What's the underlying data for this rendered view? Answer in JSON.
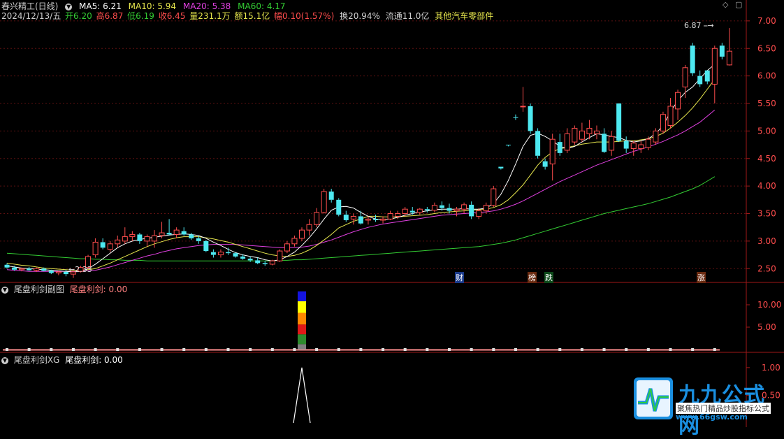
{
  "header": {
    "title": "春兴精工(日线)",
    "ma5": "MA5: 6.21",
    "ma10": "MA10: 5.94",
    "ma20": "MA20: 5.38",
    "ma60": "MA60: 4.17",
    "date": "2024/12/13/五",
    "open": "开6.20",
    "high": "高6.87",
    "low": "低6.19",
    "close": "收6.45",
    "volume": "量231.1万",
    "amount": "额15.1亿",
    "change": "幅0.10(1.57%)",
    "turnover": "换20.94%",
    "float": "流通11.0亿",
    "sector": "其他汽车零部件"
  },
  "panel2": {
    "title": "尾盘利剑副图",
    "value_label": "尾盘利剑: 0.00"
  },
  "panel3": {
    "title": "尾盘利剑XG",
    "value_label": "尾盘利剑: 0.00"
  },
  "markers": {
    "cai": "财",
    "bang": "榜",
    "die": "跌",
    "zhang": "涨"
  },
  "annotations": {
    "high_label": "6.87",
    "low_label": "←2.33"
  },
  "watermark": {
    "title": "九九公式网",
    "sub": "聚焦热门精品炒股指标公式",
    "url": "www.66gsw.com"
  },
  "colors": {
    "up": "#ff4d4d",
    "down": "#4de8f0",
    "ma5": "#ffffff",
    "ma10": "#e6e64d",
    "ma20": "#e040e0",
    "ma60": "#33cc33"
  },
  "chart_data": [
    {
      "type": "candlestick",
      "title": "春兴精工(日线)",
      "y_ticks": [
        "7.00",
        "6.50",
        "6.00",
        "5.50",
        "5.00",
        "4.50",
        "4.00",
        "3.50",
        "3.00",
        "2.50"
      ],
      "ylim": [
        2.3,
        7.1
      ],
      "candles": [
        [
          2.57,
          2.6,
          2.5,
          2.52
        ],
        [
          2.52,
          2.55,
          2.46,
          2.48
        ],
        [
          2.48,
          2.52,
          2.45,
          2.5
        ],
        [
          2.5,
          2.53,
          2.46,
          2.47
        ],
        [
          2.47,
          2.52,
          2.44,
          2.5
        ],
        [
          2.5,
          2.52,
          2.45,
          2.46
        ],
        [
          2.46,
          2.48,
          2.4,
          2.42
        ],
        [
          2.42,
          2.46,
          2.38,
          2.44
        ],
        [
          2.44,
          2.48,
          2.36,
          2.4
        ],
        [
          2.4,
          2.46,
          2.33,
          2.44
        ],
        [
          2.45,
          2.55,
          2.43,
          2.52
        ],
        [
          2.52,
          2.75,
          2.5,
          2.72
        ],
        [
          2.75,
          3.05,
          2.7,
          2.98
        ],
        [
          2.98,
          3.05,
          2.85,
          2.88
        ],
        [
          2.85,
          3.0,
          2.8,
          2.95
        ],
        [
          2.95,
          3.1,
          2.88,
          3.02
        ],
        [
          3.0,
          3.25,
          2.95,
          3.08
        ],
        [
          3.08,
          3.18,
          3.0,
          3.12
        ],
        [
          3.12,
          3.15,
          2.95,
          3.0
        ],
        [
          3.0,
          3.12,
          2.9,
          3.08
        ],
        [
          3.0,
          3.2,
          2.88,
          3.1
        ],
        [
          3.1,
          3.35,
          3.05,
          3.15
        ],
        [
          3.15,
          3.4,
          3.1,
          3.12
        ],
        [
          3.12,
          3.25,
          3.05,
          3.2
        ],
        [
          3.18,
          3.25,
          3.1,
          3.12
        ],
        [
          3.12,
          3.15,
          3.02,
          3.05
        ],
        [
          3.05,
          3.1,
          2.95,
          3.0
        ],
        [
          3.0,
          3.02,
          2.8,
          2.82
        ],
        [
          2.8,
          2.85,
          2.7,
          2.75
        ],
        [
          2.75,
          2.85,
          2.7,
          2.8
        ],
        [
          2.8,
          2.88,
          2.75,
          2.78
        ],
        [
          2.78,
          2.8,
          2.7,
          2.72
        ],
        [
          2.72,
          2.76,
          2.66,
          2.68
        ],
        [
          2.68,
          2.72,
          2.62,
          2.65
        ],
        [
          2.65,
          2.7,
          2.58,
          2.6
        ],
        [
          2.6,
          2.64,
          2.55,
          2.58
        ],
        [
          2.58,
          2.66,
          2.56,
          2.64
        ],
        [
          2.64,
          2.85,
          2.62,
          2.82
        ],
        [
          2.82,
          3.0,
          2.78,
          2.95
        ],
        [
          2.95,
          3.1,
          2.9,
          3.05
        ],
        [
          3.05,
          3.25,
          3.0,
          3.2
        ],
        [
          3.2,
          3.4,
          3.1,
          3.3
        ],
        [
          3.3,
          3.6,
          3.25,
          3.52
        ],
        [
          3.52,
          3.95,
          3.5,
          3.9
        ],
        [
          3.9,
          3.95,
          3.7,
          3.75
        ],
        [
          3.75,
          3.78,
          3.45,
          3.48
        ],
        [
          3.48,
          3.55,
          3.35,
          3.38
        ],
        [
          3.4,
          3.5,
          3.3,
          3.45
        ],
        [
          3.45,
          3.55,
          3.3,
          3.32
        ],
        [
          3.38,
          3.45,
          3.3,
          3.4
        ],
        [
          3.4,
          3.48,
          3.35,
          3.38
        ],
        [
          3.38,
          3.45,
          3.32,
          3.4
        ],
        [
          3.4,
          3.55,
          3.38,
          3.5
        ],
        [
          3.45,
          3.55,
          3.4,
          3.5
        ],
        [
          3.5,
          3.62,
          3.45,
          3.58
        ],
        [
          3.55,
          3.62,
          3.48,
          3.52
        ],
        [
          3.52,
          3.6,
          3.48,
          3.58
        ],
        [
          3.58,
          3.62,
          3.52,
          3.56
        ],
        [
          3.56,
          3.7,
          3.52,
          3.65
        ],
        [
          3.65,
          3.72,
          3.55,
          3.6
        ],
        [
          3.6,
          3.68,
          3.5,
          3.55
        ],
        [
          3.55,
          3.62,
          3.45,
          3.58
        ],
        [
          3.58,
          3.7,
          3.5,
          3.66
        ],
        [
          3.66,
          3.72,
          3.4,
          3.45
        ],
        [
          3.45,
          3.6,
          3.4,
          3.55
        ],
        [
          3.55,
          3.7,
          3.5,
          3.65
        ],
        [
          3.65,
          4.0,
          3.62,
          3.95
        ],
        [
          4.35,
          4.35,
          4.3,
          4.32
        ],
        [
          4.75,
          4.75,
          4.72,
          4.74
        ],
        [
          5.25,
          5.3,
          5.2,
          5.24
        ],
        [
          5.45,
          5.8,
          5.35,
          5.45
        ],
        [
          5.45,
          5.5,
          4.95,
          5.0
        ],
        [
          5.0,
          5.05,
          4.5,
          4.55
        ],
        [
          4.45,
          4.5,
          4.3,
          4.35
        ],
        [
          4.4,
          4.95,
          4.1,
          4.85
        ],
        [
          4.8,
          4.95,
          4.55,
          4.6
        ],
        [
          4.65,
          5.05,
          4.6,
          4.95
        ],
        [
          4.8,
          5.1,
          4.75,
          5.05
        ],
        [
          4.85,
          5.15,
          4.8,
          5.0
        ],
        [
          4.95,
          5.2,
          4.85,
          5.05
        ],
        [
          4.95,
          5.1,
          4.85,
          5.0
        ],
        [
          4.95,
          5.05,
          4.6,
          4.62
        ],
        [
          4.65,
          5.0,
          4.55,
          4.9
        ],
        [
          5.5,
          5.5,
          4.8,
          4.82
        ],
        [
          4.82,
          4.9,
          4.6,
          4.68
        ],
        [
          4.68,
          4.82,
          4.55,
          4.78
        ],
        [
          4.68,
          4.82,
          4.6,
          4.75
        ],
        [
          4.7,
          4.9,
          4.65,
          4.85
        ],
        [
          4.8,
          5.05,
          4.75,
          5.0
        ],
        [
          5.0,
          5.35,
          4.95,
          5.3
        ],
        [
          5.1,
          5.6,
          5.05,
          5.45
        ],
        [
          5.4,
          5.75,
          5.2,
          5.7
        ],
        [
          5.8,
          6.2,
          5.6,
          6.15
        ],
        [
          6.55,
          6.6,
          6.0,
          6.05
        ],
        [
          6.0,
          6.1,
          5.8,
          5.85
        ],
        [
          6.1,
          6.1,
          5.85,
          5.9
        ],
        [
          5.85,
          6.55,
          5.5,
          6.5
        ],
        [
          6.55,
          6.6,
          6.3,
          6.35
        ],
        [
          6.2,
          6.87,
          6.19,
          6.45
        ]
      ],
      "ma5": [
        2.55,
        2.53,
        2.51,
        2.5,
        2.49,
        2.48,
        2.47,
        2.46,
        2.45,
        2.44,
        2.45,
        2.5,
        2.58,
        2.68,
        2.78,
        2.88,
        2.95,
        3.0,
        3.03,
        3.05,
        3.07,
        3.09,
        3.11,
        3.12,
        3.13,
        3.12,
        3.1,
        3.05,
        2.98,
        2.92,
        2.85,
        2.79,
        2.75,
        2.72,
        2.7,
        2.66,
        2.64,
        2.66,
        2.72,
        2.8,
        2.92,
        3.06,
        3.22,
        3.4,
        3.56,
        3.62,
        3.63,
        3.6,
        3.52,
        3.45,
        3.4,
        3.39,
        3.4,
        3.43,
        3.47,
        3.5,
        3.53,
        3.55,
        3.57,
        3.58,
        3.58,
        3.58,
        3.59,
        3.58,
        3.58,
        3.6,
        3.68,
        3.85,
        4.1,
        4.4,
        4.72,
        4.92,
        4.96,
        4.9,
        4.82,
        4.72,
        4.68,
        4.72,
        4.8,
        4.88,
        4.95,
        4.93,
        4.9,
        4.88,
        4.83,
        4.8,
        4.82,
        4.86,
        4.95,
        5.1,
        5.35,
        5.55,
        5.7,
        5.8,
        5.95,
        6.1,
        6.21
      ],
      "ma10": [
        2.6,
        2.58,
        2.56,
        2.55,
        2.53,
        2.51,
        2.5,
        2.49,
        2.48,
        2.47,
        2.47,
        2.48,
        2.5,
        2.55,
        2.6,
        2.66,
        2.72,
        2.78,
        2.84,
        2.9,
        2.95,
        2.99,
        3.03,
        3.06,
        3.08,
        3.08,
        3.08,
        3.06,
        3.04,
        3.01,
        2.98,
        2.94,
        2.9,
        2.86,
        2.82,
        2.78,
        2.75,
        2.73,
        2.72,
        2.74,
        2.78,
        2.84,
        2.92,
        3.02,
        3.12,
        3.24,
        3.3,
        3.36,
        3.4,
        3.45,
        3.45,
        3.44,
        3.44,
        3.44,
        3.45,
        3.46,
        3.47,
        3.48,
        3.5,
        3.52,
        3.53,
        3.54,
        3.55,
        3.56,
        3.57,
        3.58,
        3.61,
        3.66,
        3.75,
        3.88,
        4.02,
        4.2,
        4.38,
        4.52,
        4.62,
        4.68,
        4.7,
        4.73,
        4.76,
        4.78,
        4.8,
        4.8,
        4.8,
        4.81,
        4.82,
        4.82,
        4.84,
        4.86,
        4.9,
        4.96,
        5.05,
        5.16,
        5.28,
        5.42,
        5.58,
        5.76,
        5.94
      ],
      "ma20": [
        2.48,
        2.47,
        2.46,
        2.45,
        2.45,
        2.45,
        2.45,
        2.45,
        2.45,
        2.45,
        2.45,
        2.46,
        2.47,
        2.5,
        2.53,
        2.57,
        2.61,
        2.65,
        2.69,
        2.73,
        2.76,
        2.8,
        2.83,
        2.86,
        2.88,
        2.9,
        2.92,
        2.93,
        2.94,
        2.94,
        2.94,
        2.94,
        2.93,
        2.92,
        2.91,
        2.9,
        2.89,
        2.88,
        2.88,
        2.88,
        2.89,
        2.91,
        2.94,
        2.98,
        3.02,
        3.07,
        3.12,
        3.17,
        3.21,
        3.25,
        3.28,
        3.31,
        3.33,
        3.35,
        3.37,
        3.39,
        3.41,
        3.43,
        3.45,
        3.47,
        3.48,
        3.49,
        3.5,
        3.51,
        3.52,
        3.53,
        3.55,
        3.58,
        3.62,
        3.67,
        3.73,
        3.8,
        3.87,
        3.94,
        4.01,
        4.08,
        4.14,
        4.2,
        4.26,
        4.32,
        4.38,
        4.43,
        4.48,
        4.53,
        4.58,
        4.63,
        4.67,
        4.71,
        4.76,
        4.81,
        4.87,
        4.93,
        5.0,
        5.08,
        5.16,
        5.27,
        5.38
      ],
      "ma60": [
        2.78,
        2.77,
        2.76,
        2.75,
        2.74,
        2.73,
        2.72,
        2.71,
        2.7,
        2.69,
        2.68,
        2.68,
        2.67,
        2.67,
        2.66,
        2.66,
        2.65,
        2.65,
        2.65,
        2.64,
        2.64,
        2.64,
        2.64,
        2.64,
        2.64,
        2.64,
        2.64,
        2.64,
        2.64,
        2.64,
        2.64,
        2.64,
        2.64,
        2.64,
        2.64,
        2.64,
        2.64,
        2.65,
        2.65,
        2.66,
        2.66,
        2.67,
        2.68,
        2.69,
        2.7,
        2.71,
        2.72,
        2.73,
        2.74,
        2.75,
        2.76,
        2.77,
        2.78,
        2.79,
        2.8,
        2.81,
        2.82,
        2.83,
        2.84,
        2.85,
        2.86,
        2.87,
        2.88,
        2.89,
        2.9,
        2.92,
        2.94,
        2.96,
        2.99,
        3.02,
        3.06,
        3.1,
        3.14,
        3.18,
        3.22,
        3.26,
        3.3,
        3.34,
        3.38,
        3.42,
        3.46,
        3.5,
        3.53,
        3.56,
        3.59,
        3.62,
        3.65,
        3.68,
        3.72,
        3.76,
        3.8,
        3.85,
        3.9,
        3.95,
        4.01,
        4.09,
        4.17
      ]
    },
    {
      "type": "bar",
      "title": "尾盘利剑副图",
      "y_ticks": [
        "10.00",
        "5.00"
      ],
      "ylim": [
        0,
        12.5
      ],
      "signal_index": 40,
      "signal_segments": [
        {
          "from": 0,
          "to": 1.2,
          "color": "#808080"
        },
        {
          "from": 1.2,
          "to": 3.4,
          "color": "#2e8b2e"
        },
        {
          "from": 3.4,
          "to": 5.6,
          "color": "#e01818"
        },
        {
          "from": 5.6,
          "to": 8.2,
          "color": "#ff8800"
        },
        {
          "from": 8.2,
          "to": 10.8,
          "color": "#ffff00"
        },
        {
          "from": 10.8,
          "to": 13.0,
          "color": "#1414e0"
        }
      ]
    },
    {
      "type": "line",
      "title": "尾盘利剑XG",
      "y_ticks": [
        "1.00",
        "0.50"
      ],
      "ylim": [
        0,
        1.15
      ],
      "signal_index": 40,
      "signal_value": 1
    }
  ]
}
